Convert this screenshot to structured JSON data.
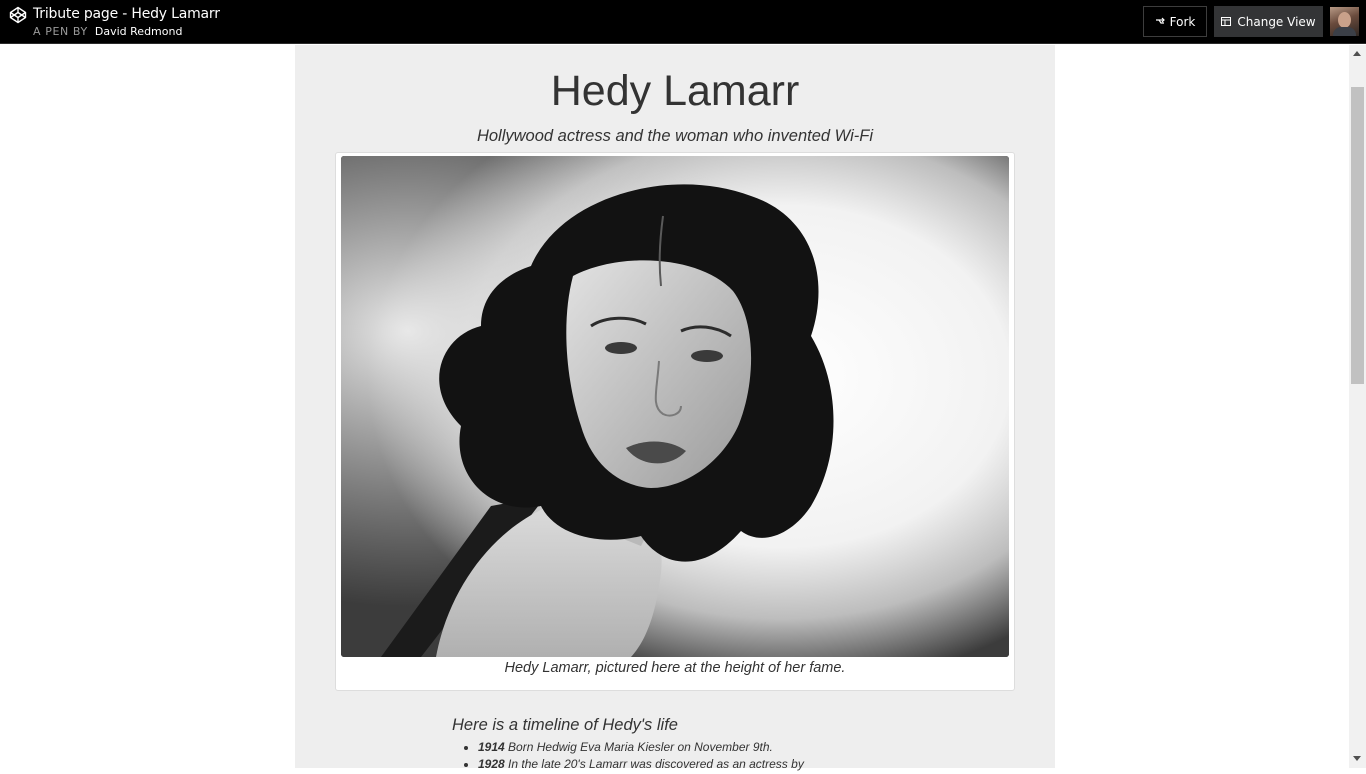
{
  "topbar": {
    "logo_icon": "codepen-logo-icon",
    "title": "Tribute page - Hedy Lamarr",
    "by_label": "A PEN BY",
    "author": "David Redmond",
    "fork_label": "Fork",
    "fork_icon": "fork-icon",
    "change_view_label": "Change View",
    "change_view_icon": "layout-icon",
    "avatar_icon": "user-avatar"
  },
  "main": {
    "heading": "Hedy Lamarr",
    "subtitle": "Hollywood actress and the woman who invented Wi-Fi",
    "image_caption": "Hedy Lamarr, pictured here at the height of her fame.",
    "timeline_title": "Here is a timeline of Hedy's life",
    "timeline": [
      {
        "year": "1914",
        "text": "Born Hedwig Eva Maria Kiesler on November 9th."
      },
      {
        "year": "1928",
        "text": "In the late 20's Lamarr was discovered as an actress by"
      }
    ]
  },
  "colors": {
    "topbar_bg": "#000000",
    "page_bg": "#eeeeee",
    "text": "#333333",
    "change_view_bg": "#333436"
  }
}
